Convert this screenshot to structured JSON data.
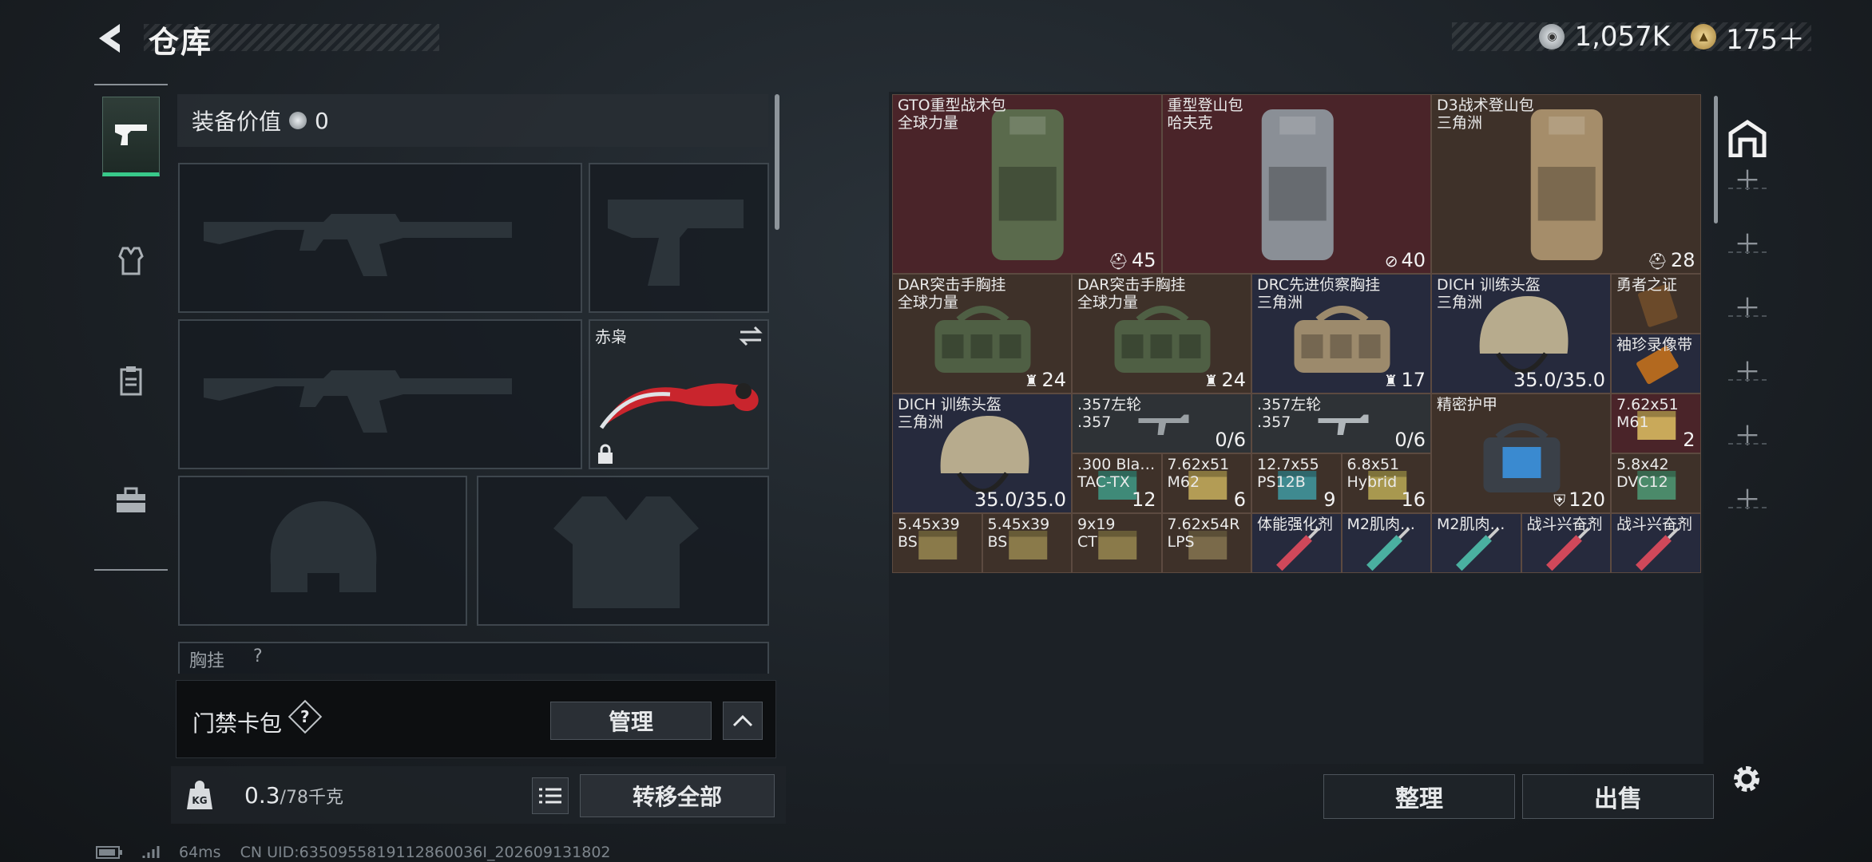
{
  "header": {
    "title": "仓库",
    "currencies": [
      {
        "value": "1,057K",
        "icon": "silver-coin-icon",
        "color": "#c8ccd0"
      },
      {
        "value": "175＋",
        "icon": "gold-coin-icon",
        "color": "#d9b56a"
      }
    ]
  },
  "equipment": {
    "value_label": "装备价值",
    "value": "0",
    "knife_name": "赤枭",
    "chest_label": "胸挂",
    "chest_hint": "?"
  },
  "keycard": {
    "label": "门禁卡包",
    "help": "?",
    "manage": "管理"
  },
  "weight": {
    "current": "0.3",
    "max": "/78千克",
    "transfer": "转移全部"
  },
  "items": [
    {
      "name": [
        "GTO重型战术包",
        "全球力量"
      ],
      "count": "45",
      "icon": "backpack-icon"
    },
    {
      "name": [
        "重型登山包",
        "哈夫克"
      ],
      "count": "40",
      "icon": "slash-icon"
    },
    {
      "name": [
        "D3战术登山包",
        "三角洲"
      ],
      "count": "28",
      "icon": "backpack-icon"
    },
    {
      "name": [
        "DAR突击手胸挂",
        "全球力量"
      ],
      "count": "24",
      "icon": "vest-icon"
    },
    {
      "name": [
        "DAR突击手胸挂",
        "全球力量"
      ],
      "count": "24",
      "icon": "vest-icon"
    },
    {
      "name": [
        "DRC先进侦察胸挂",
        "三角洲"
      ],
      "count": "17",
      "icon": "vest-icon"
    },
    {
      "name": [
        "DICH 训练头盔",
        "三角洲"
      ],
      "count": "35.0/35.0"
    },
    {
      "name": [
        "勇者之证"
      ],
      "count": ""
    },
    {
      "name": [
        "袖珍录像带"
      ],
      "count": ""
    },
    {
      "name": [
        "DICH 训练头盔",
        "三角洲"
      ],
      "count": "35.0/35.0"
    },
    {
      "name": [
        ".357左轮",
        ".357"
      ],
      "count": "0/6"
    },
    {
      "name": [
        ".357左轮",
        ".357"
      ],
      "count": "0/6"
    },
    {
      "name": [
        "精密护甲"
      ],
      "count": "120",
      "icon": "shield-icon"
    },
    {
      "name": [
        "7.62x51",
        "M61"
      ],
      "count": "2"
    },
    {
      "name": [
        ".300 Bla…",
        "TAC-TX"
      ],
      "count": "12"
    },
    {
      "name": [
        "7.62x51",
        "M62"
      ],
      "count": "6"
    },
    {
      "name": [
        "12.7x55",
        "PS12B"
      ],
      "count": "9"
    },
    {
      "name": [
        "6.8x51",
        "Hybrid"
      ],
      "count": "16"
    },
    {
      "name": [
        "5.8x42",
        "DVC12"
      ],
      "count": ""
    },
    {
      "name": [
        "5.45x39",
        "BS"
      ],
      "count": ""
    },
    {
      "name": [
        "5.45x39",
        "BS"
      ],
      "count": ""
    },
    {
      "name": [
        "9x19",
        "CT"
      ],
      "count": ""
    },
    {
      "name": [
        "7.62x54R",
        "LPS"
      ],
      "count": ""
    },
    {
      "name": [
        "体能强化剂"
      ],
      "count": ""
    },
    {
      "name": [
        "M2肌肉…"
      ],
      "count": ""
    },
    {
      "name": [
        "M2肌肉…"
      ],
      "count": ""
    },
    {
      "name": [
        "战斗兴奋剂"
      ],
      "count": ""
    },
    {
      "name": [
        "战斗兴奋剂"
      ],
      "count": ""
    }
  ],
  "actions": {
    "sort": "整理",
    "sell": "出售"
  },
  "footer": {
    "ping": "64ms",
    "uid": "CN UID:6350955819112860036I_202609131802"
  }
}
